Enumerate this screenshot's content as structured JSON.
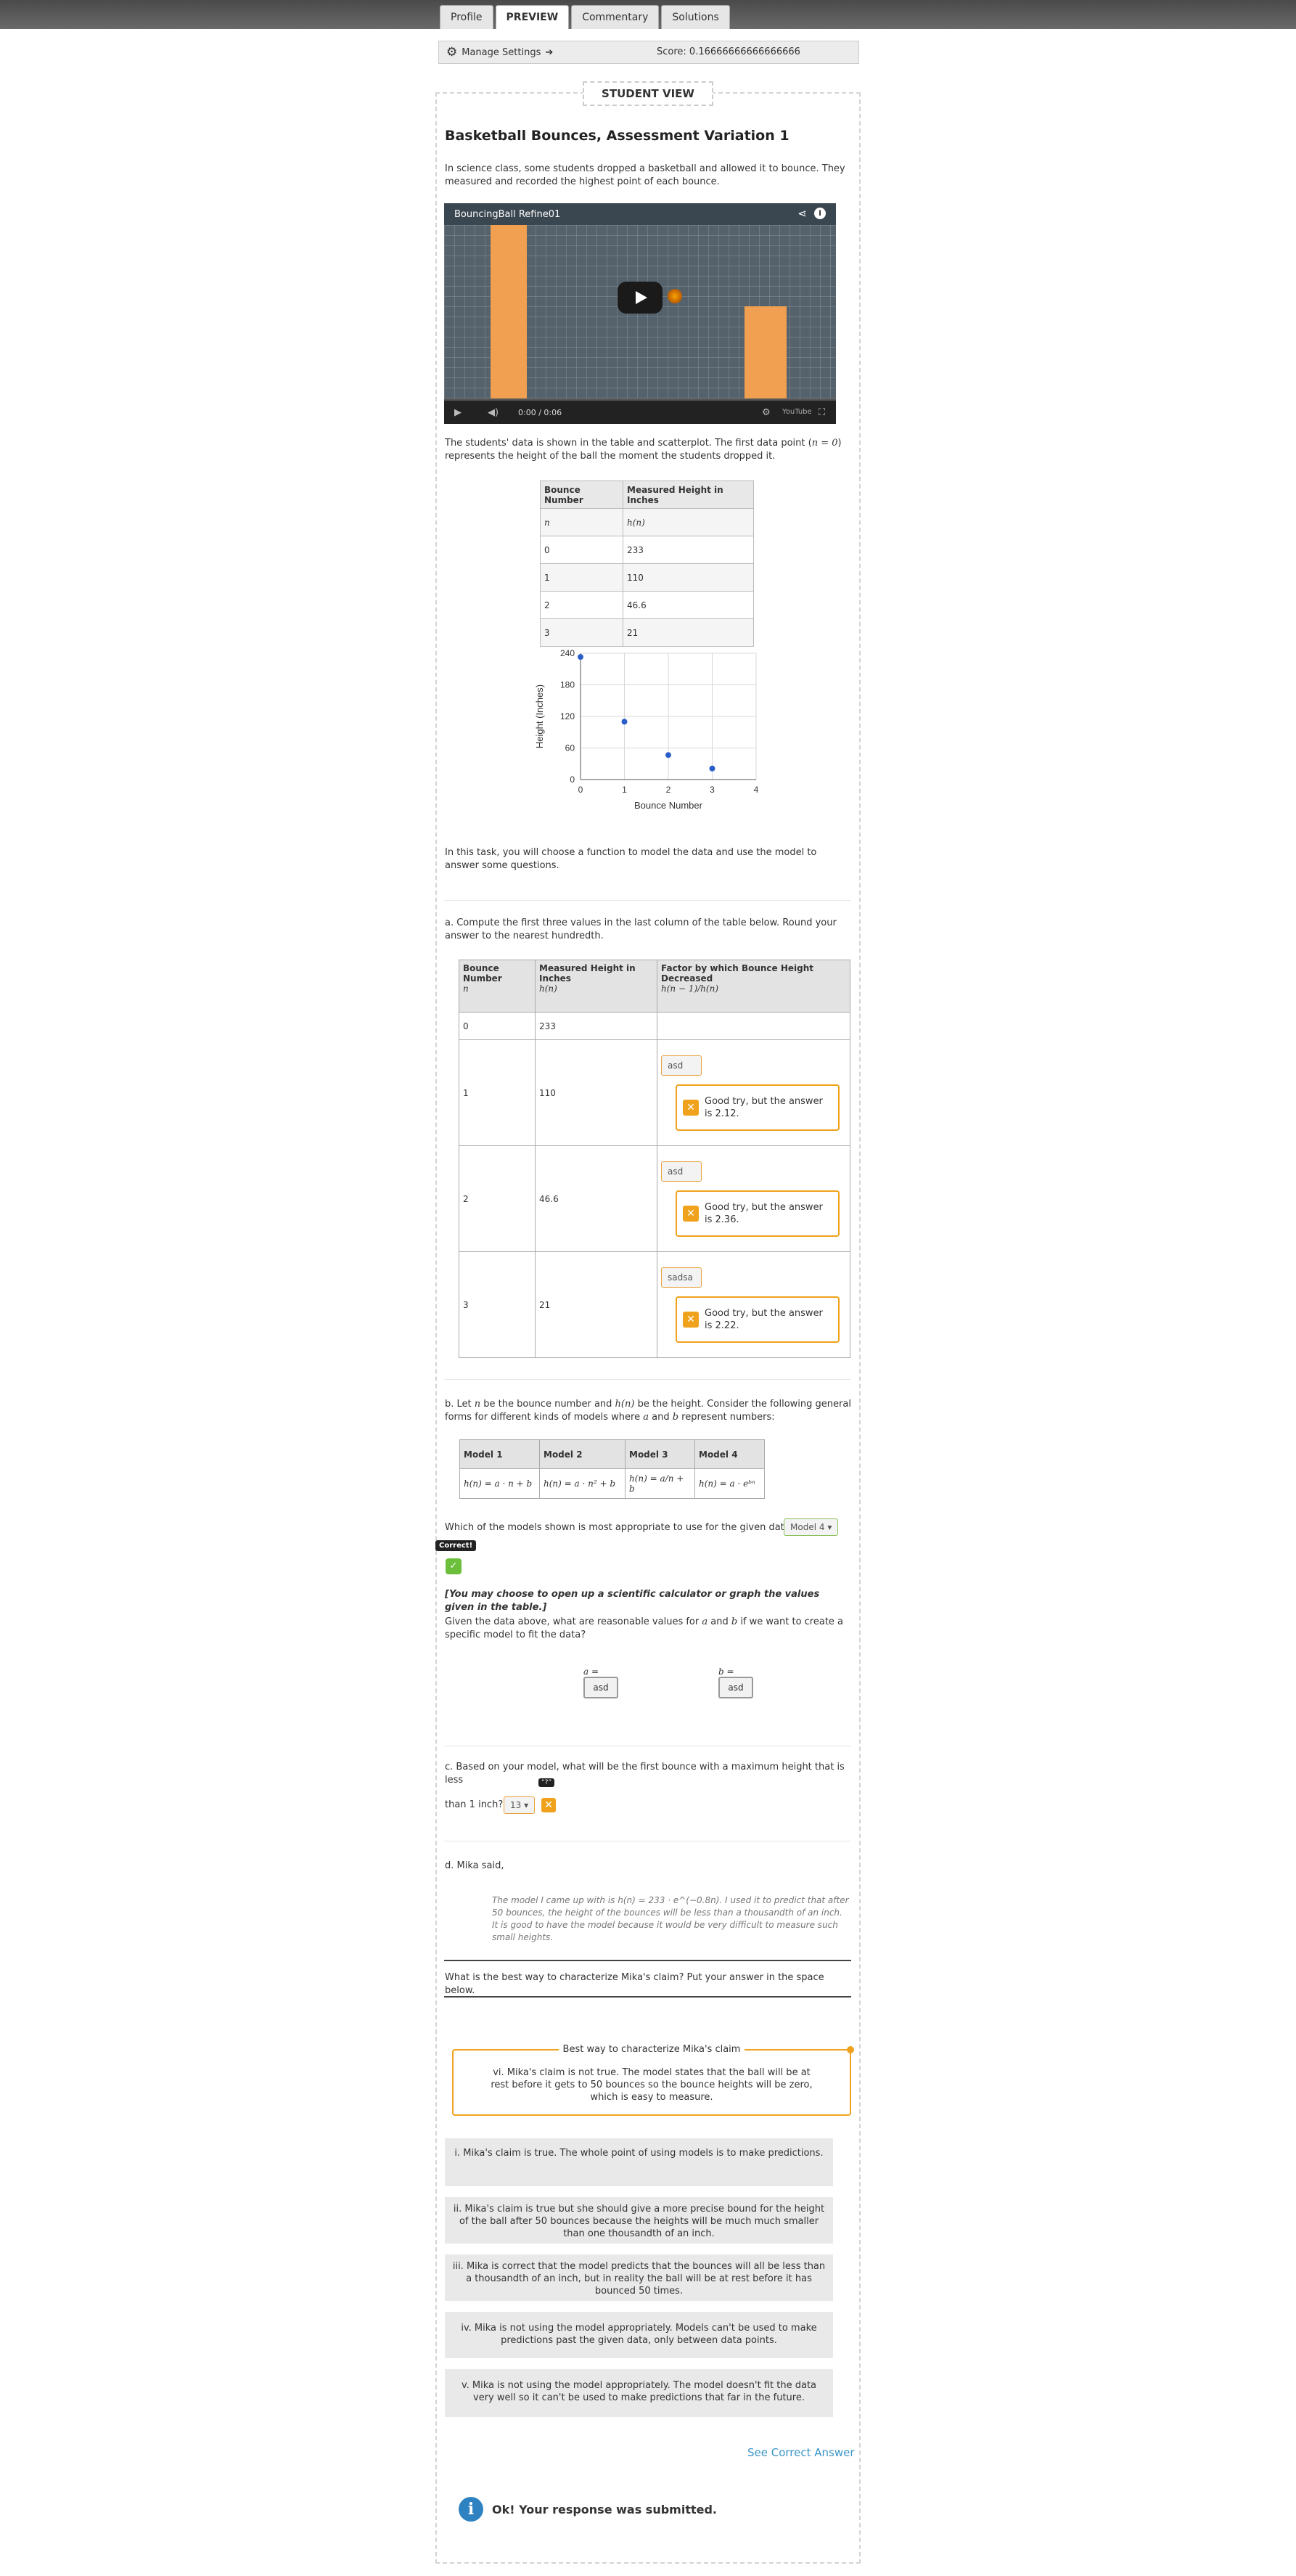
{
  "tabs": [
    "Profile",
    "PREVIEW",
    "Commentary",
    "Solutions"
  ],
  "settings": {
    "manage_label": "Manage Settings",
    "arrow": "➔",
    "score": "Score: 0.16666666666666666"
  },
  "student_view_label": "STUDENT VIEW",
  "title": "Basketball Bounces, Assessment Variation 1",
  "intro": "In science class, some students dropped a basketball and allowed it to bounce. They measured and recorded the highest point of each bounce.",
  "video": {
    "title": "BouncingBall Refine01",
    "time": "0:00 / 0:06",
    "brand": "YouTube"
  },
  "data_text_1": "The students' data is shown in the table and scatterplot. The first data point (",
  "data_text_math": "n = 0",
  "data_text_2": ") represents the height of the ball the moment the students dropped it.",
  "data_table": {
    "headers": [
      "Bounce Number",
      "Measured Height in Inches"
    ],
    "subheaders": [
      "n",
      "h(n)"
    ],
    "rows": [
      [
        "0",
        "233"
      ],
      [
        "1",
        "110"
      ],
      [
        "2",
        "46.6"
      ],
      [
        "3",
        "21"
      ]
    ]
  },
  "chart_data": {
    "type": "scatter",
    "x": [
      0,
      1,
      2,
      3
    ],
    "y": [
      233,
      110,
      46.6,
      21
    ],
    "xlabel": "Bounce Number",
    "ylabel": "Height (Inches)",
    "xlim": [
      0,
      4
    ],
    "ylim": [
      0,
      240
    ],
    "xticks": [
      "0",
      "1",
      "2",
      "3",
      "4"
    ],
    "yticks": [
      "0",
      "60",
      "120",
      "180",
      "240"
    ],
    "grid": true,
    "point_color": "#2a5fc9"
  },
  "task_text": "In this task, you will choose a function to model the data and use the model to answer some questions.",
  "part_a": {
    "prompt": "a. Compute the first three values in the last column of the table below. Round your answer to the nearest hundredth.",
    "headers": [
      "Bounce Number",
      "Measured Height in Inches",
      "Factor by which Bounce Height Decreased"
    ],
    "subheaders": [
      "n",
      "h(n)",
      "h(n − 1)/h(n)"
    ],
    "rows": [
      {
        "n": "0",
        "h": "233"
      },
      {
        "n": "1",
        "h": "110",
        "input": "asd",
        "feedback": "Good try, but the answer is 2.12."
      },
      {
        "n": "2",
        "h": "46.6",
        "input": "asd",
        "feedback": "Good try, but the answer is 2.36."
      },
      {
        "n": "3",
        "h": "21",
        "input": "sadsa",
        "feedback": "Good try, but the answer is 2.22."
      }
    ]
  },
  "part_b": {
    "prompt_1": "b. Let ",
    "prompt_n": "n",
    "prompt_2": " be the bounce number and ",
    "prompt_hn": "h(n)",
    "prompt_3": " be the height. Consider the following general forms for different kinds of models where ",
    "prompt_a": "a",
    "prompt_4": " and ",
    "prompt_b": "b",
    "prompt_5": " represent numbers:",
    "models": [
      "Model 1",
      "Model 2",
      "Model 3",
      "Model 4"
    ],
    "formulas": [
      "h(n) = a · n + b",
      "h(n) = a · n² + b",
      "h(n) = a/n + b",
      "h(n) = a · eᵇⁿ"
    ],
    "question": "Which of the models shown is most appropriate to use for the given data?",
    "selected": "Model 4",
    "correct_label": "Correct!",
    "calc_note": "[You may choose to open up a scientific calculator or graph the values given in the table.]",
    "values_prompt_1": "Given the data above, what are reasonable values for ",
    "values_prompt_a": "a",
    "values_prompt_2": " and ",
    "values_prompt_b": "b",
    "values_prompt_3": " if we want to create a specific model to fit the data?",
    "a_label": "a =",
    "a_value": "asd",
    "b_label": "b =",
    "b_value": "asd"
  },
  "part_c": {
    "prompt_1": "c. Based on your model, what will be the first bounce with a maximum height that is less",
    "prompt_2": "than 1 inch?",
    "selected": "13",
    "tooltip": "“?”"
  },
  "part_d": {
    "intro": "d. Mika said,",
    "quote_1": "The model I came up with is ",
    "quote_math": "h(n) = 233 · e^(−0.8n)",
    "quote_2": ". I used it to predict that after 50 bounces, the height of the bounces will be less than a thousandth of an inch. It is good to have the model because it would be very difficult to measure such small heights.",
    "question": "What is the best way to characterize Mika's claim? Put your answer in the space below.",
    "box_label": "Best way to characterize Mika's claim",
    "placed_answer": "vi. Mika's claim is not true. The model states that the ball will be at rest before it gets to 50 bounces so the bounce heights will be zero, which is easy to measure.",
    "choices": [
      "i. Mika's claim is true. The whole point of using models is to make predictions.",
      "ii. Mika's claim is true but she should give a more precise bound for the height of the ball after 50 bounces because the heights will be much much smaller than one thousandth of an inch.",
      "iii. Mika is correct that the model predicts that the bounces will all be less than a thousandth of an inch, but in reality the ball will be at rest before it has bounced 50 times.",
      "iv. Mika is not using the model appropriately. Models can't be used to make predictions past the given data, only between data points.",
      "v. Mika is not using the model appropriately. The model doesn't fit the data very well so it can't be used to make predictions that far in the future."
    ]
  },
  "see_correct": "See Correct Answer",
  "submitted": "Ok! Your response was submitted."
}
